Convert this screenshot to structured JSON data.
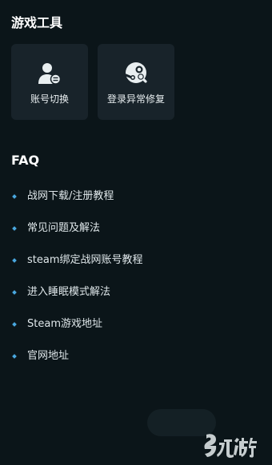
{
  "tools": {
    "title": "游戏工具",
    "items": [
      {
        "label": "账号切换",
        "icon": "user-switch-icon"
      },
      {
        "label": "登录异常修复",
        "icon": "steam-repair-icon"
      }
    ]
  },
  "faq": {
    "title": "FAQ",
    "items": [
      "战网下载/注册教程",
      "常见问题及解法",
      "steam绑定战网账号教程",
      "进入睡眠模式解法",
      "Steam游戏地址",
      "官网地址"
    ]
  },
  "watermark": {
    "text": "九游",
    "icon": "jiuyou-logo-icon"
  },
  "colors": {
    "background": "#0b1519",
    "card": "#18232a",
    "bullet": "#4aa8e0",
    "icon": "#e8eef0"
  }
}
